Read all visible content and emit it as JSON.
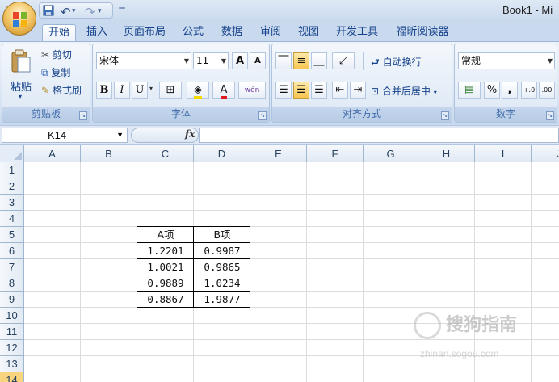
{
  "window": {
    "title": "Book1 - Mi"
  },
  "qat": {
    "save_icon": "save-icon",
    "undo": "↶",
    "redo": "↷",
    "customize": "▾"
  },
  "ribbon": {
    "tabs": [
      "开始",
      "插入",
      "页面布局",
      "公式",
      "数据",
      "审阅",
      "视图",
      "开发工具",
      "福昕阅读器"
    ],
    "active_tab": "开始",
    "clipboard": {
      "label": "剪贴板",
      "paste": "粘贴",
      "cut": "剪切",
      "copy": "复制",
      "format_painter": "格式刷"
    },
    "font": {
      "label": "字体",
      "font_name": "宋体",
      "font_size": "11",
      "bold": "B",
      "italic": "I",
      "underline": "U",
      "font_color_letter": "A",
      "phonetic": "wén",
      "grow": "A",
      "shrink": "A"
    },
    "alignment": {
      "label": "对齐方式",
      "wrap_text": "自动换行",
      "merge_center": "合并后居中"
    },
    "number": {
      "label": "数字",
      "format": "常规",
      "percent": "%",
      "comma": ",",
      "inc_decimal": "+.0",
      "dec_decimal": ".00"
    }
  },
  "formula_bar": {
    "name_box": "K14",
    "fx": "fx",
    "formula": ""
  },
  "sheet": {
    "columns": [
      "A",
      "B",
      "C",
      "D",
      "E",
      "F",
      "G",
      "H",
      "I",
      "J"
    ],
    "rows": [
      "1",
      "2",
      "3",
      "4",
      "5",
      "6",
      "7",
      "8",
      "9",
      "10",
      "11",
      "12",
      "13",
      "14"
    ],
    "selected_row": "14",
    "table": {
      "headers": [
        "A项",
        "B项"
      ],
      "rows": [
        [
          "1.2201",
          "0.9987"
        ],
        [
          "1.0021",
          "0.9865"
        ],
        [
          "0.9889",
          "1.0234"
        ],
        [
          "0.8867",
          "1.9877"
        ]
      ]
    }
  },
  "watermark": {
    "text": "搜狗指南",
    "url": "zhinan.sogou.com"
  },
  "colors": {
    "ribbon": "#dde8f5",
    "grid_line": "#dadcdd",
    "header": "#e1e9f4",
    "selected_row": "#f8d47e"
  }
}
